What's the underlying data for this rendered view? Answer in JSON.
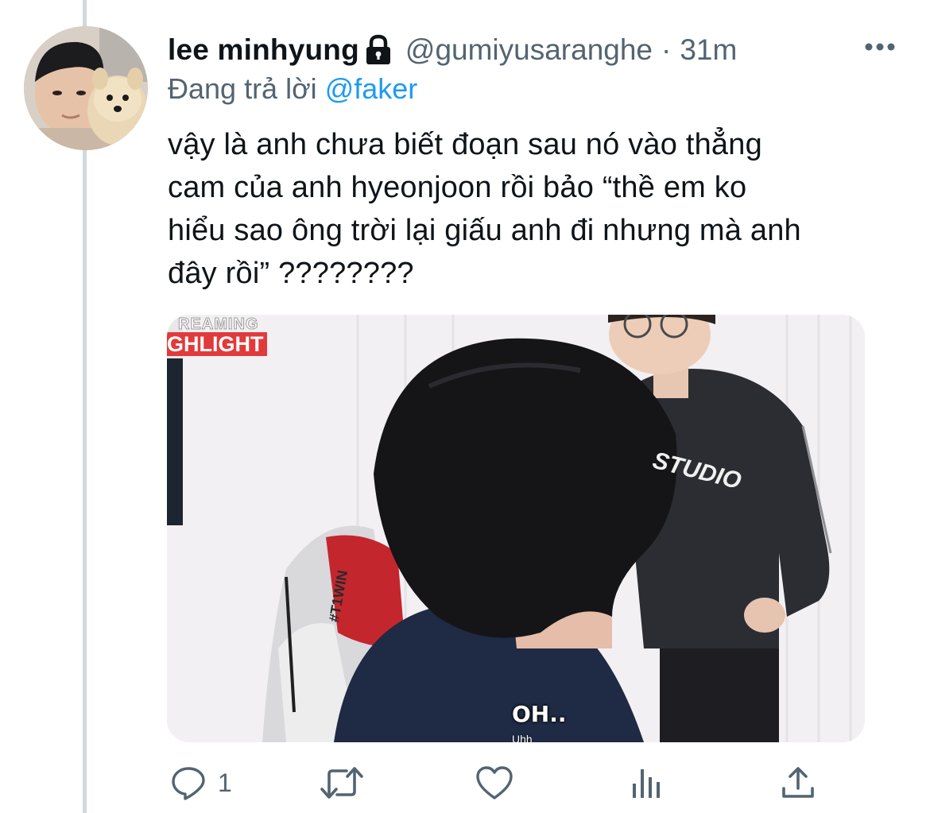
{
  "tweet": {
    "display_name": "lee minhyung",
    "handle": "@gumiyusaranghe",
    "separator": "·",
    "time": "31m",
    "replying_to_prefix": "Đang trả lời",
    "replying_to_handle": "@faker",
    "text": "vậy là anh chưa biết đoạn sau nó vào thẳng\ncam của anh hyeonjoon rồi bảo “thề em ko\nhiểu sao ông trời lại giấu anh đi nhưng mà anh\nđây rồi” ????????",
    "protected_icon": "lock-icon",
    "more_icon": "ellipsis-icon"
  },
  "media": {
    "logo_top": "REAMING",
    "logo_bottom": "GHLIGHT",
    "jersey_text": "#T1WIN",
    "shirt_text": "STUDIO",
    "caption_main": "OH..",
    "caption_sub": "Uhh"
  },
  "actions": {
    "reply_count": "1",
    "reply_icon": "reply-icon",
    "retweet_icon": "retweet-icon",
    "like_icon": "heart-icon",
    "views_icon": "views-icon",
    "share_icon": "share-icon"
  },
  "colors": {
    "text_primary": "#0f1419",
    "text_secondary": "#536471",
    "link": "#1d9bf0",
    "thread_line": "#cfd9de"
  }
}
